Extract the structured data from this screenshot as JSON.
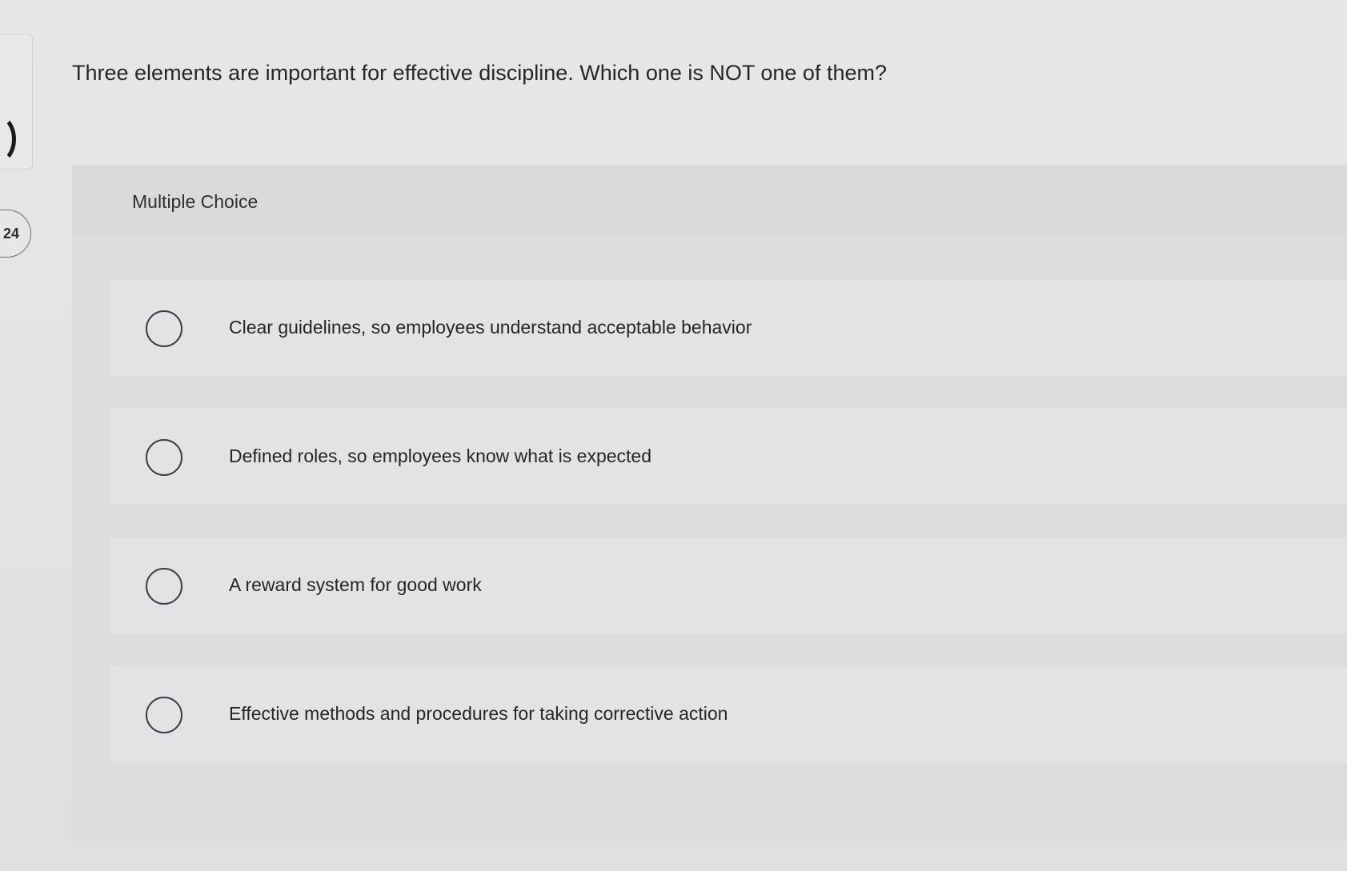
{
  "question_number": "24",
  "question": {
    "text": "Three elements are important for effective discipline. Which one is NOT one of them?"
  },
  "answer_panel": {
    "type_label": "Multiple Choice",
    "options": [
      {
        "label": "Clear guidelines, so employees understand acceptable behavior"
      },
      {
        "label": "Defined roles, so employees know what is expected"
      },
      {
        "label": "A reward system for good work"
      },
      {
        "label": "Effective methods and procedures for taking corrective action"
      }
    ]
  }
}
